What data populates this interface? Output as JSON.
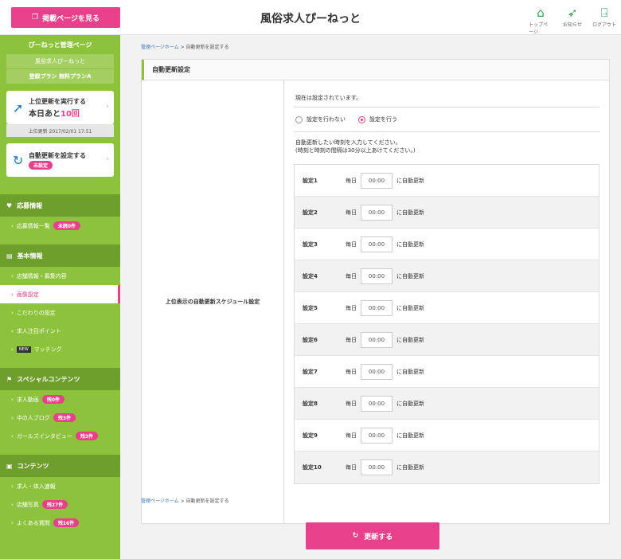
{
  "header": {
    "post_button": "掲載ページを見る",
    "site_title": "風俗求人ぴーねっと",
    "icons": [
      {
        "icon": "home-icon",
        "label": "トップページ"
      },
      {
        "icon": "paper-plane-icon",
        "label": "お知らせ"
      },
      {
        "icon": "logout-icon",
        "label": "ログアウト"
      }
    ]
  },
  "sidebar": {
    "admin_title": "ぴーねっと管理ページ",
    "shop_name": "風俗求人ぴーねっと",
    "plan_label": "登録プラン 無料プランA",
    "top_update_card": {
      "line1": "上位更新を実行する",
      "line2_prefix": "本日あと",
      "line2_count": "10回"
    },
    "last_update": "上位更新 2017/02/01 17:51",
    "auto_update_card": {
      "line1": "自動更新を設定する",
      "badge": "未設定"
    },
    "sections": [
      {
        "title": "応募情報",
        "items": [
          {
            "label": "応募情報一覧",
            "badge": "未読0件"
          }
        ]
      },
      {
        "title": "基本情報",
        "items": [
          {
            "label": "店舗情報・募集内容"
          },
          {
            "label": "画像設定"
          },
          {
            "label": "こだわりの設定"
          },
          {
            "label": "求人注目ポイント"
          },
          {
            "label": "マッチング",
            "tag": "NEW"
          }
        ]
      },
      {
        "title": "スペシャルコンテンツ",
        "items": [
          {
            "label": "求人動画",
            "badge": "残0件"
          },
          {
            "label": "中の人ブログ",
            "badge": "残3件"
          },
          {
            "label": "ガールズインタビュー",
            "badge": "残3件"
          }
        ]
      },
      {
        "title": "コンテンツ",
        "items": [
          {
            "label": "求人・体入速報"
          },
          {
            "label": "店舗写真",
            "badge": "残27件"
          },
          {
            "label": "よくある質問",
            "badge": "残16件"
          }
        ]
      }
    ]
  },
  "main": {
    "breadcrumb_link": "管理ページホーム",
    "breadcrumb_current": "自動更新を設定する",
    "panel_title": "自動更新設定",
    "field_label": "上位表示の自動更新スケジュール設定",
    "current_status": "現在は設定されています。",
    "radio_off": "設定を行わない",
    "radio_on": "設定を行う",
    "instruction_1": "自動更新したい時刻を入力してください。",
    "instruction_2": "(時刻と時刻の間隔は30分以上あけてください。)",
    "schedules": [
      {
        "name": "設定1",
        "every": "毎日",
        "time": "00:00",
        "suffix": "に自動更新"
      },
      {
        "name": "設定2",
        "every": "毎日",
        "time": "00:00",
        "suffix": "に自動更新"
      },
      {
        "name": "設定3",
        "every": "毎日",
        "time": "00:00",
        "suffix": "に自動更新"
      },
      {
        "name": "設定4",
        "every": "毎日",
        "time": "00:00",
        "suffix": "に自動更新"
      },
      {
        "name": "設定5",
        "every": "毎日",
        "time": "00:00",
        "suffix": "に自動更新"
      },
      {
        "name": "設定6",
        "every": "毎日",
        "time": "00:00",
        "suffix": "に自動更新"
      },
      {
        "name": "設定7",
        "every": "毎日",
        "time": "00:00",
        "suffix": "に自動更新"
      },
      {
        "name": "設定8",
        "every": "毎日",
        "time": "00:00",
        "suffix": "に自動更新"
      },
      {
        "name": "設定9",
        "every": "毎日",
        "time": "00:00",
        "suffix": "に自動更新"
      },
      {
        "name": "設定10",
        "every": "毎日",
        "time": "00:00",
        "suffix": "に自動更新"
      }
    ],
    "submit_label": "更新する"
  },
  "colors": {
    "accent": "#e8408b",
    "sidebar": "#8dc33c",
    "section": "#6e9e2c",
    "link": "#3477c0"
  }
}
